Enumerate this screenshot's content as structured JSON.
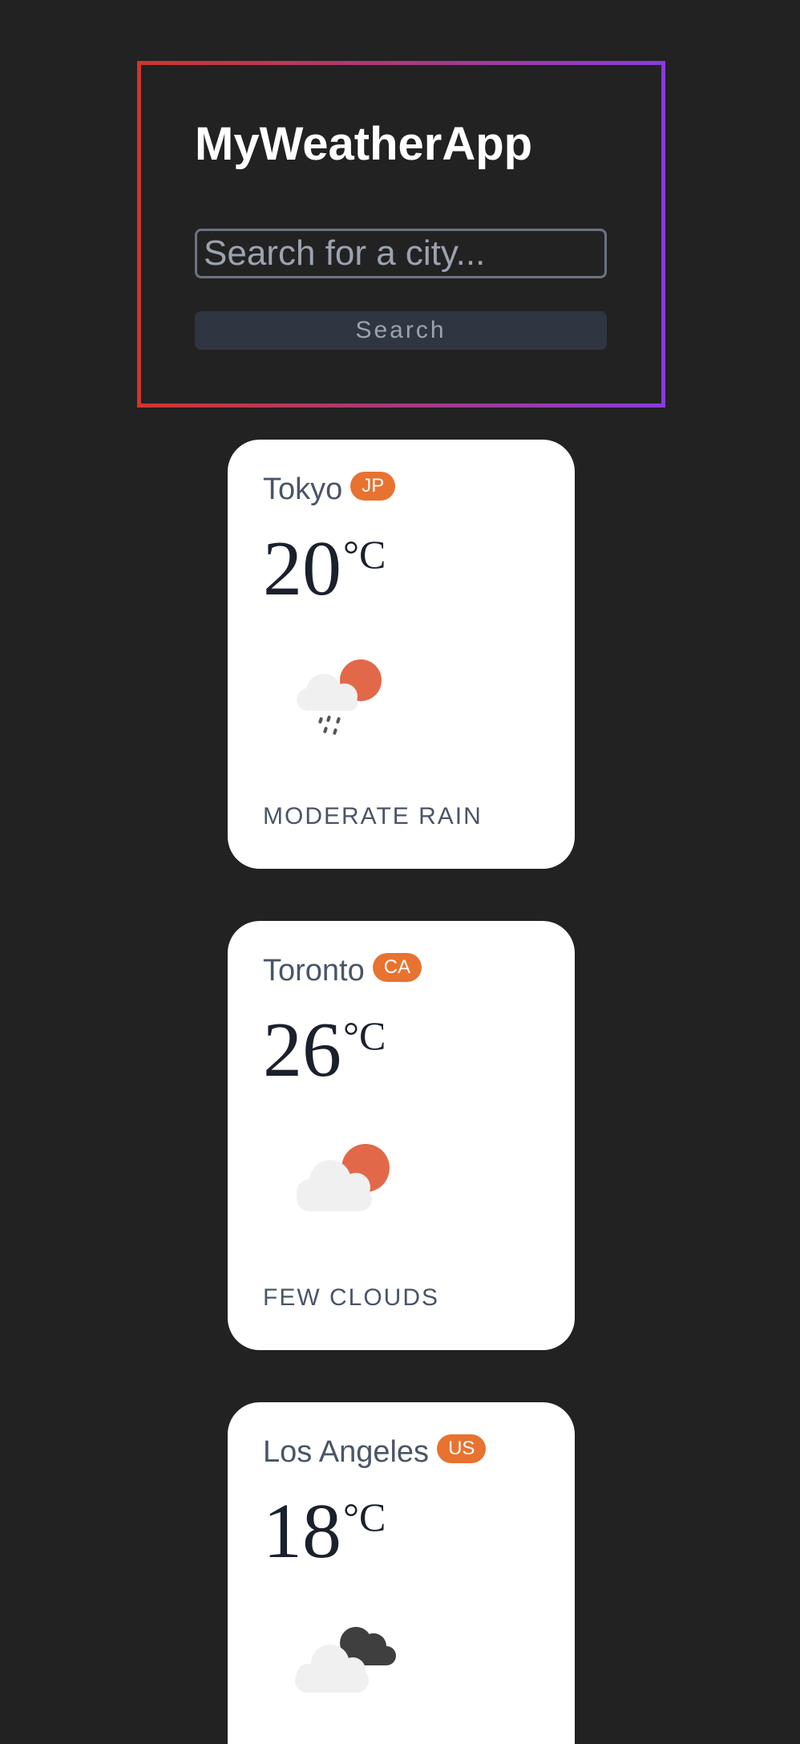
{
  "header": {
    "title": "MyWeatherApp",
    "search_placeholder": "Search for a city...",
    "search_button_label": "Search",
    "border_gradient": [
      "#d1352b",
      "#8a3be0"
    ]
  },
  "cards": [
    {
      "city": "Tokyo",
      "country": "JP",
      "temperature": "20",
      "unit": "°C",
      "description": "MODERATE RAIN",
      "icon": "sun-cloud-rain-icon"
    },
    {
      "city": "Toronto",
      "country": "CA",
      "temperature": "26",
      "unit": "°C",
      "description": "FEW CLOUDS",
      "icon": "sun-cloud-icon"
    },
    {
      "city": "Los Angeles",
      "country": "US",
      "temperature": "18",
      "unit": "°C",
      "description": "",
      "icon": "broken-clouds-icon"
    }
  ],
  "colors": {
    "background": "#222222",
    "card": "#ffffff",
    "badge": "#e8722f",
    "sun": "#e2684a"
  }
}
